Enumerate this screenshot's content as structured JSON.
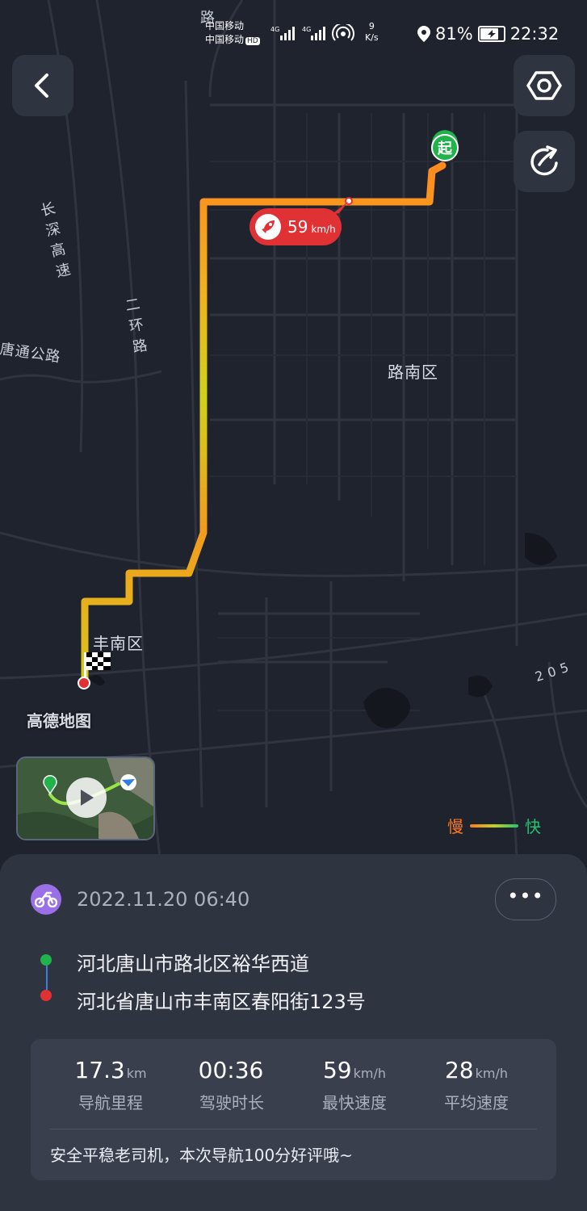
{
  "status_bar": {
    "carrier_1": "中国移动",
    "carrier_2": "中国移动",
    "hd_badge": "HD",
    "network_1": "4G",
    "network_2": "4G",
    "net_speed_value": "9",
    "net_speed_unit": "K/s",
    "battery_percent": "81%",
    "battery_level": 0.81,
    "time": "22:32",
    "icons": [
      "signal-icon",
      "wifi-hotspot-icon",
      "location-icon",
      "battery-charging-icon"
    ]
  },
  "header": {
    "back_icon": "chevron-left-icon",
    "settings_icon": "hexagon-settings-icon",
    "share_icon": "share-icon"
  },
  "map": {
    "start_marker": "起",
    "max_speed_value": "59",
    "max_speed_unit": "km/h",
    "labels": {
      "district_lunan": "路南区",
      "district_fengnan": "丰南区",
      "road_tangtong": "唐通公路",
      "road_changshen": "长深高速",
      "road_erhuan": "二环路",
      "road_top": "路",
      "road_205": "205"
    },
    "watermark": "高德地图",
    "legend_slow": "慢",
    "legend_fast": "快",
    "colors": {
      "route_slow": "#ff7a1e",
      "route_mid": "#c6d21a",
      "route_fast": "#21c470",
      "start_green": "#21b24b",
      "end_red": "#e03134"
    }
  },
  "trip": {
    "datetime": "2022.11.20 06:40",
    "more_label": "•••",
    "start_address": "河北唐山市路北区裕华西道",
    "end_address": "河北省唐山市丰南区春阳街123号",
    "stats": [
      {
        "value": "17.3",
        "unit": "km",
        "label": "导航里程"
      },
      {
        "value": "00:36",
        "unit": "",
        "label": "驾驶时长"
      },
      {
        "value": "59",
        "unit": "km/h",
        "label": "最快速度"
      },
      {
        "value": "28",
        "unit": "km/h",
        "label": "平均速度"
      }
    ],
    "comment": "安全平稳老司机，本次导航100分好评哦~"
  }
}
